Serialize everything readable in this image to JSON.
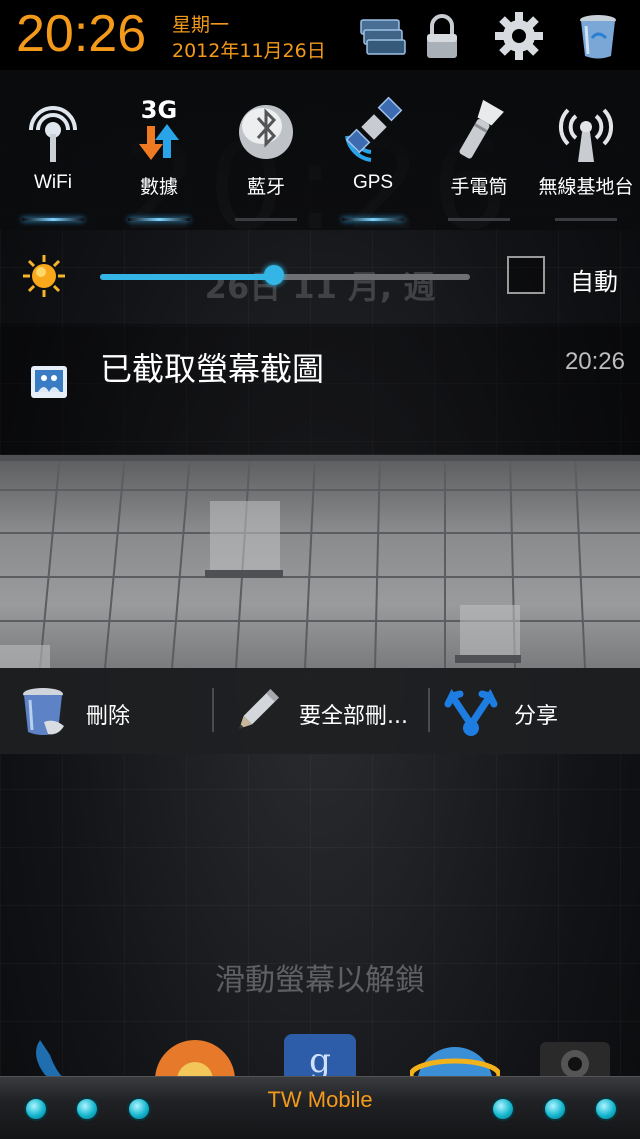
{
  "status_bar": {
    "time": "20:26",
    "weekday": "星期一",
    "date": "2012年11月26日",
    "icons": [
      "recent-apps-icon",
      "lock-icon",
      "settings-icon",
      "trash-icon"
    ]
  },
  "background": {
    "clock": "20:26",
    "date": "26日 11 月, 週",
    "unlock_hint": "滑動螢幕以解鎖"
  },
  "toggles": [
    {
      "label": "WiFi",
      "icon": "wifi-icon",
      "on": true
    },
    {
      "label": "數據",
      "icon": "3g-data-icon",
      "badge": "3G",
      "on": true
    },
    {
      "label": "藍牙",
      "icon": "bluetooth-icon",
      "on": false
    },
    {
      "label": "GPS",
      "icon": "gps-satellite-icon",
      "on": true
    },
    {
      "label": "手電筒",
      "icon": "flashlight-icon",
      "on": false
    },
    {
      "label": "無線基地台",
      "icon": "hotspot-icon",
      "on": false
    }
  ],
  "brightness": {
    "level": 0.47,
    "auto_label": "自動",
    "auto_checked": false
  },
  "notification": {
    "title": "已截取螢幕截圖",
    "time": "20:26"
  },
  "actions": [
    {
      "label": "刪除",
      "icon": "trash-icon"
    },
    {
      "label": "要全部刪...",
      "icon": "pencil-icon"
    },
    {
      "label": "分享",
      "icon": "share-icon"
    }
  ],
  "bottom_bar": {
    "carrier": "TW Mobile"
  },
  "colors": {
    "accent_orange": "#f39a1a",
    "holo_blue": "#33b5e5",
    "dot_cyan": "#14b7cf"
  }
}
